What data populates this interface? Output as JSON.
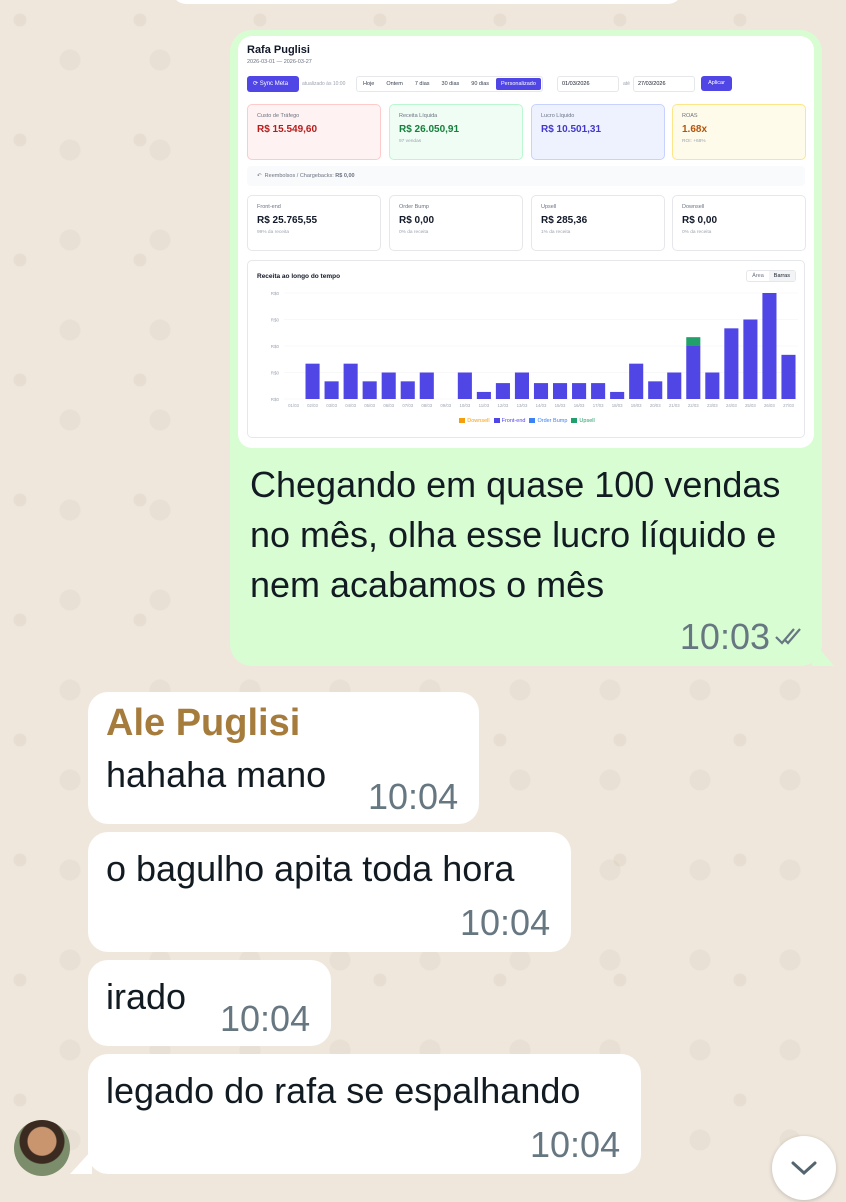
{
  "chat": {
    "outgoing": {
      "text": "Chegando em quase 100 vendas no mês, olha esse lucro líquido e nem acabamos o mês",
      "time": "10:03"
    },
    "incoming": [
      {
        "sender": "Ale Puglisi",
        "text": "hahaha mano",
        "time": "10:04"
      },
      {
        "text": "o bagulho apita toda hora",
        "time": "10:04"
      },
      {
        "text": "irado",
        "time": "10:04"
      },
      {
        "text": "legado do rafa se espalhando",
        "time": "10:04"
      }
    ]
  },
  "dashboard": {
    "title": "Rafa Puglisi",
    "date_range": "2026-03-01 — 2026-03-27",
    "sync_label": "Sync Meta",
    "updated_label": "atualizado às 10:00",
    "filters": [
      "Hoje",
      "Ontem",
      "7 dias",
      "30 dias",
      "90 dias",
      "Personalizado"
    ],
    "active_filter": "Personalizado",
    "date_from": "01/03/2026",
    "date_until_label": "até",
    "date_to": "27/03/2026",
    "apply_label": "Aplicar",
    "metrics": [
      {
        "label": "Custo de Tráfego",
        "value": "R$ 15.549,60",
        "note": "",
        "color": "#b91c1c",
        "bg": "#fef2f2",
        "border": "#fecaca"
      },
      {
        "label": "Receita Líquida",
        "value": "R$ 26.050,91",
        "note": "97 vendas",
        "color": "#15803d",
        "bg": "#f0fdf4",
        "border": "#bbf7d0"
      },
      {
        "label": "Lucro Líquido",
        "value": "R$ 10.501,31",
        "note": "",
        "color": "#4338ca",
        "bg": "#eef2ff",
        "border": "#c7d2fe"
      },
      {
        "label": "ROAS",
        "value": "1.68x",
        "note": "ROI: +68%",
        "color": "#b45309",
        "bg": "#fffbeb",
        "border": "#fde68a"
      }
    ],
    "refunds_label": "Reembolsos / Chargebacks:",
    "refunds_value": "R$ 0,00",
    "products": [
      {
        "label": "Front-end",
        "value": "R$ 25.765,55",
        "note": "99% da receita"
      },
      {
        "label": "Order Bump",
        "value": "R$ 0,00",
        "note": "0% da receita"
      },
      {
        "label": "Upsell",
        "value": "R$ 285,36",
        "note": "1% da receita"
      },
      {
        "label": "Downsell",
        "value": "R$ 0,00",
        "note": "0% da receita"
      }
    ],
    "chart_toggle": [
      "Área",
      "Barras"
    ],
    "chart_toggle_active": "Barras"
  },
  "chart_data": {
    "type": "bar",
    "title": "Receita ao longo do tempo",
    "stacked": true,
    "categories": [
      "01/03",
      "02/03",
      "03/03",
      "04/03",
      "05/03",
      "06/03",
      "07/03",
      "08/03",
      "09/03",
      "10/03",
      "11/03",
      "12/03",
      "13/03",
      "14/03",
      "15/03",
      "16/03",
      "17/03",
      "18/03",
      "19/03",
      "20/03",
      "21/03",
      "22/03",
      "23/03",
      "24/03",
      "25/03",
      "26/03",
      "27/03"
    ],
    "y_tick_labels": [
      "R$0",
      "R$0",
      "R$0",
      "R$0",
      "R$0"
    ],
    "series": [
      {
        "name": "Downsell",
        "color": "#f59e0b",
        "values": [
          0,
          0,
          0,
          0,
          0,
          0,
          0,
          0,
          0,
          0,
          0,
          0,
          0,
          0,
          0,
          0,
          0,
          0,
          0,
          0,
          0,
          0,
          0,
          0,
          0,
          0,
          0
        ]
      },
      {
        "name": "Front-end",
        "color": "#4f46e5",
        "values": [
          0,
          2.0,
          1.0,
          2.0,
          1.0,
          1.5,
          1.0,
          1.5,
          0,
          1.5,
          0.4,
          0.9,
          1.5,
          0.9,
          0.9,
          0.9,
          0.9,
          0.4,
          2.0,
          1.0,
          1.5,
          3.0,
          1.5,
          4.0,
          4.5,
          6.0,
          2.5
        ]
      },
      {
        "name": "Order Bump",
        "color": "#3b82f6",
        "values": [
          0,
          0,
          0,
          0,
          0,
          0,
          0,
          0,
          0,
          0,
          0,
          0,
          0,
          0,
          0,
          0,
          0,
          0,
          0,
          0,
          0,
          0,
          0,
          0,
          0,
          0,
          0
        ]
      },
      {
        "name": "Upsell",
        "color": "#22a06b",
        "values": [
          0,
          0,
          0,
          0,
          0,
          0,
          0,
          0,
          0,
          0,
          0,
          0,
          0,
          0,
          0,
          0,
          0,
          0,
          0,
          0,
          0,
          0.5,
          0,
          0,
          0,
          0,
          0
        ]
      }
    ],
    "ylim": [
      0,
      6
    ],
    "grid": true,
    "legend": "bottom"
  }
}
